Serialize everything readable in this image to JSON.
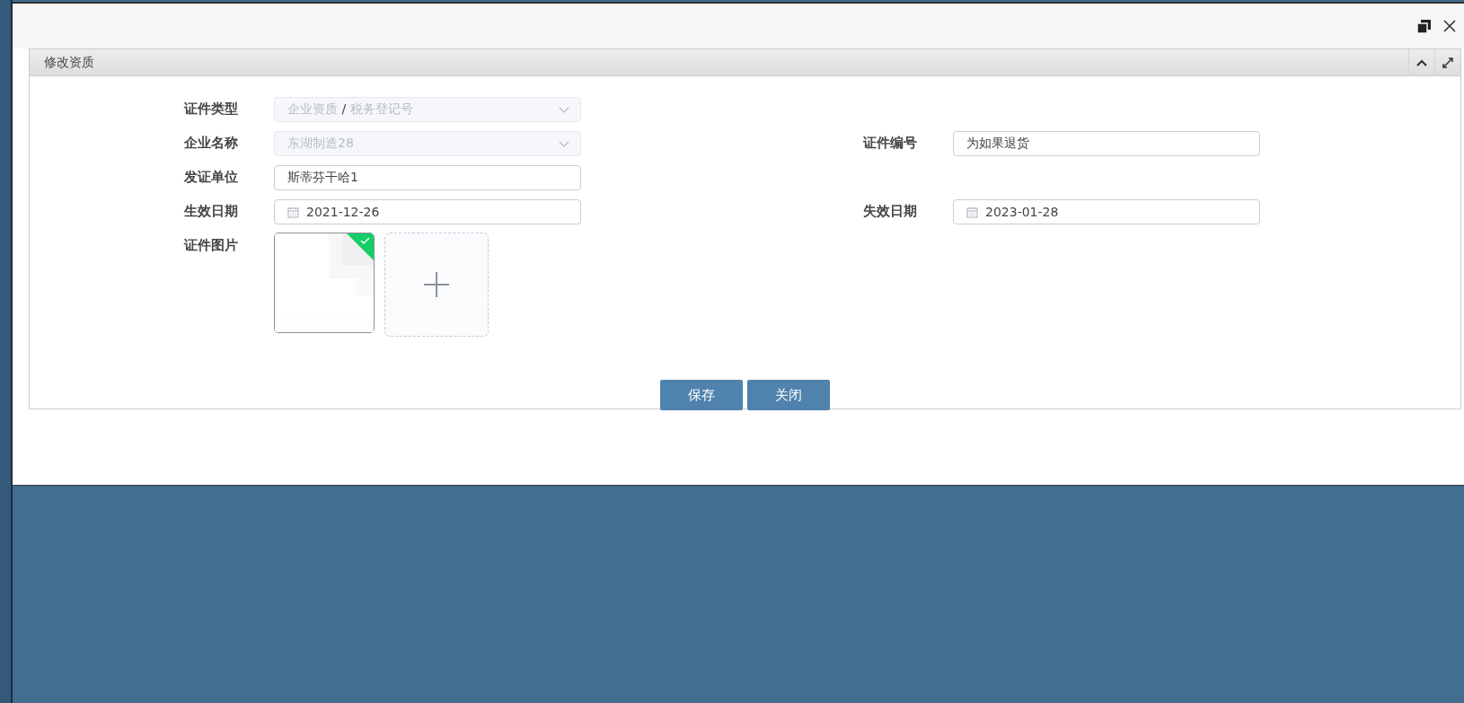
{
  "panel": {
    "title": "修改资质",
    "collapsed": false
  },
  "rows": [
    {
      "left": {
        "label": "证件类型",
        "kind": "select",
        "value": "企业资质 **/** 税务登记号",
        "disabled": true
      }
    },
    {
      "left": {
        "label": "企业名称",
        "kind": "select",
        "value": "东湖制造28",
        "disabled": true
      },
      "right": {
        "label": "证件编号",
        "kind": "text",
        "value": "为如果退货",
        "disabled": false
      }
    },
    {
      "left": {
        "label": "发证单位",
        "kind": "text",
        "value": "斯蒂芬干哈1",
        "disabled": false
      }
    },
    {
      "left": {
        "label": "生效日期",
        "kind": "date",
        "value": "2021-12-26",
        "disabled": false
      },
      "right": {
        "label": "失效日期",
        "kind": "date",
        "value": "2023-01-28",
        "disabled": false
      }
    }
  ],
  "images": {
    "label": "证件图片",
    "files": [
      {
        "kind": "picture",
        "uploaded": true
      }
    ]
  },
  "buttons": [
    "保存",
    "关闭"
  ]
}
